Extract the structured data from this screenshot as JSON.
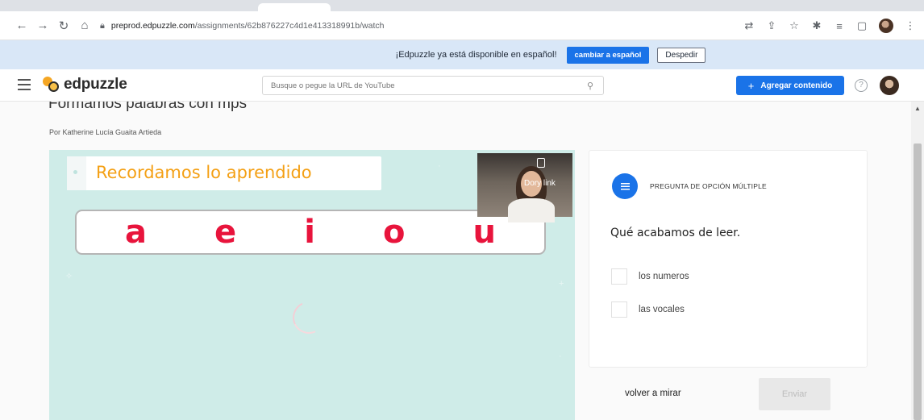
{
  "browser": {
    "url_host": "preprod.edpuzzle.com",
    "url_path": "/assignments/62b876227c4d1e413318991b/watch"
  },
  "banner": {
    "message": "¡Edpuzzle ya está disponible en español!",
    "cta_label": "cambiar a español",
    "dismiss_label": "Despedir"
  },
  "header": {
    "logo_text": "edpuzzle",
    "search_placeholder": "Busque o pegue la URL de YouTube",
    "add_content_label": "Agregar contenido",
    "help_symbol": "?"
  },
  "assignment": {
    "title": "Formamos palabras con mps",
    "author": "Por Katherine Lucía Guaita Artieda"
  },
  "video": {
    "caption": "Recordamos lo aprendido",
    "vowels": [
      "a",
      "e",
      "i",
      "o",
      "u"
    ],
    "webcam_label": "Dory link"
  },
  "question": {
    "type_label": "PREGUNTA DE OPCIÓN MÚLTIPLE",
    "text": "Qué acabamos de leer.",
    "options": [
      "los numeros",
      "las vocales"
    ]
  },
  "actions": {
    "rewatch_label": "volver a mirar",
    "submit_label": "Enviar"
  },
  "colors": {
    "accent": "#1a73e8",
    "banner_bg": "#d9e7f7",
    "video_bg": "#cfece8",
    "vowel": "#e8143c",
    "caption": "#f4a015"
  }
}
